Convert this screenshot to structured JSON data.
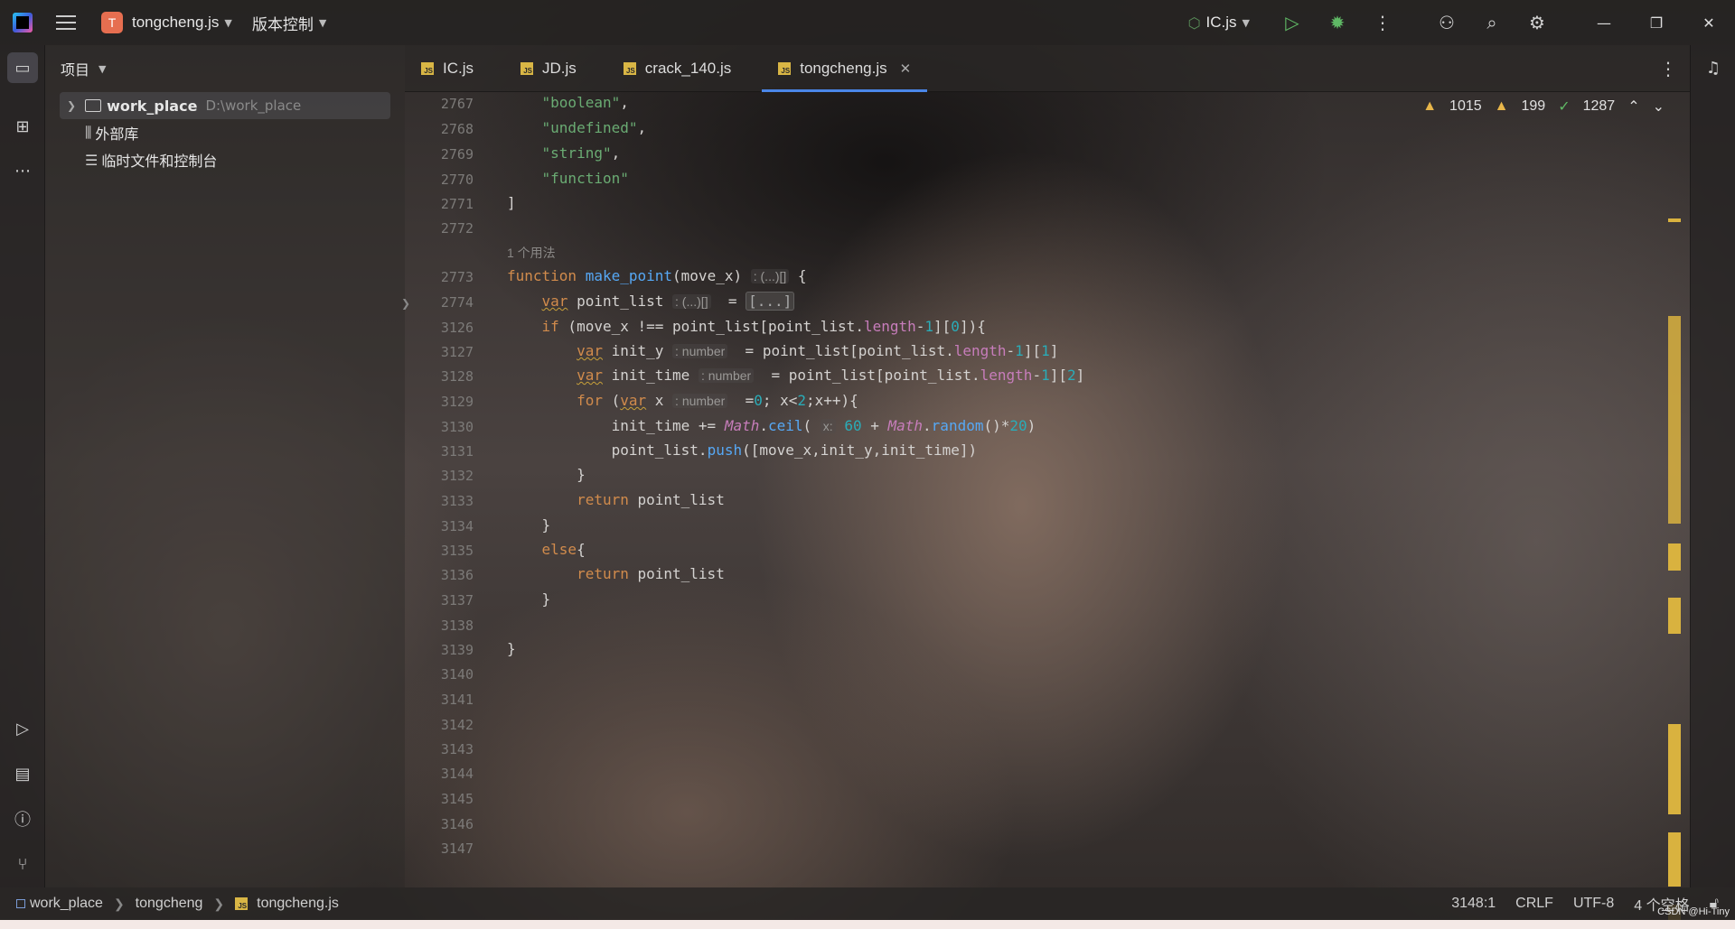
{
  "topbar": {
    "project_badge": "T",
    "project_name": "tongcheng.js",
    "vcs_menu": "版本控制",
    "run_config": "IC.js"
  },
  "project_panel": {
    "title": "项目",
    "tree": [
      {
        "label": "work_place",
        "hint": "D:\\work_place"
      },
      {
        "label": "外部库"
      },
      {
        "label": "临时文件和控制台"
      }
    ]
  },
  "tabs": [
    {
      "label": "IC.js"
    },
    {
      "label": "JD.js"
    },
    {
      "label": "crack_140.js"
    },
    {
      "label": "tongcheng.js",
      "active": true
    }
  ],
  "inspections": {
    "errors": "1015",
    "warnings": "199",
    "ok": "1287"
  },
  "editor": {
    "line_numbers": [
      "2767",
      "2768",
      "2769",
      "2770",
      "2771",
      "2772",
      "2773",
      "2774",
      "3126",
      "3127",
      "3128",
      "3129",
      "3130",
      "3131",
      "3132",
      "3133",
      "3134",
      "3135",
      "3136",
      "3137",
      "3138",
      "3139",
      "3140",
      "3141",
      "3142",
      "3143",
      "3144",
      "3145",
      "3146",
      "3147"
    ],
    "usage_hint": "1 个用法",
    "hint_array": ": (...)[]",
    "hint_number": ": number",
    "hint_x": "x:",
    "folded": "[...]"
  },
  "statusbar": {
    "crumbs": [
      "work_place",
      "tongcheng",
      "tongcheng.js"
    ],
    "position": "3148:1",
    "line_sep": "CRLF",
    "encoding": "UTF-8",
    "indent": "4 个空格"
  },
  "watermark": "CSDN @Hi-Tiny",
  "colors": {
    "accent": "#4a86e8",
    "keyword": "#d18b4c",
    "string": "#6aab73",
    "function": "#56a8f5",
    "number": "#2aacb8",
    "warning": "#d9b23f"
  }
}
